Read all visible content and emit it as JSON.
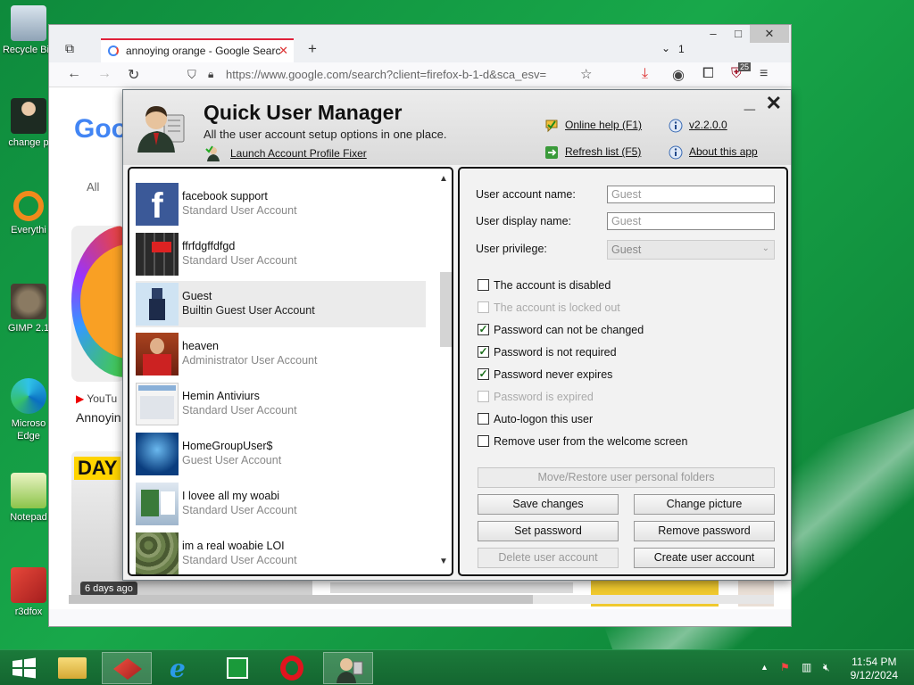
{
  "desktop": {
    "icons": [
      {
        "label": "Recycle Bin",
        "icon": "recycle-bin-icon"
      },
      {
        "label": "change p",
        "icon": "user-icon"
      },
      {
        "label": "Everythi",
        "icon": "everything-search-icon"
      },
      {
        "label": "GIMP 2.1",
        "icon": "gimp-icon"
      },
      {
        "label": "Microso Edge",
        "icon": "edge-icon"
      },
      {
        "label": "Notepad",
        "icon": "notepad-icon"
      },
      {
        "label": "r3dfox",
        "icon": "r3dfox-icon"
      }
    ]
  },
  "browser": {
    "tab_title": "annoying orange - Google Searc",
    "tab_count": "1",
    "url": "https://www.google.com/search?client=firefox-b-1-d&sca_esv=",
    "ext_badge": "25",
    "page": {
      "logo": "Goo",
      "tab_all": "All",
      "source": "YouTu",
      "result_title": "Annoyin",
      "days_ago": "6 days ago",
      "thumb_text": "DAY"
    }
  },
  "qum": {
    "title": "Quick User Manager",
    "subtitle": "All the user account setup options in one place.",
    "launch_link": "Launch Account Profile Fixer",
    "online_help": "Online help (F1)",
    "refresh_list": "Refresh list (F5)",
    "version": "v2.2.0.0",
    "about": "About this app",
    "users": [
      {
        "name": "facebook support",
        "type": "Standard User Account",
        "selected": false,
        "thumb": "facebook-icon"
      },
      {
        "name": "ffrfdgffdfgd",
        "type": "Standard User Account",
        "selected": false,
        "thumb": "keyboard-icon"
      },
      {
        "name": "Guest",
        "type": "Builtin Guest User Account",
        "selected": true,
        "thumb": "roblox-avatar-icon"
      },
      {
        "name": "heaven",
        "type": "Administrator User Account",
        "selected": false,
        "thumb": "painting-icon"
      },
      {
        "name": "Hemin Antiviurs",
        "type": "Standard User Account",
        "selected": false,
        "thumb": "window-icon"
      },
      {
        "name": "HomeGroupUser$",
        "type": "Guest User Account",
        "selected": false,
        "thumb": "homegroup-icon"
      },
      {
        "name": "I lovee all my woabi",
        "type": "Standard User Account",
        "selected": false,
        "thumb": "screenshot-icon"
      },
      {
        "name": "im a real woabie LOI",
        "type": "Standard User Account",
        "selected": false,
        "thumb": "camouflage-icon"
      }
    ],
    "details": {
      "account_name_label": "User account name:",
      "account_name_value": "Guest",
      "display_name_label": "User display name:",
      "display_name_value": "Guest",
      "privilege_label": "User privilege:",
      "privilege_value": "Guest"
    },
    "checkboxes": [
      {
        "label": "The account is disabled",
        "checked": false,
        "disabled": false
      },
      {
        "label": "The account is locked out",
        "checked": false,
        "disabled": true
      },
      {
        "label": "Password can not be changed",
        "checked": true,
        "disabled": false
      },
      {
        "label": "Password is not required",
        "checked": true,
        "disabled": false
      },
      {
        "label": "Password never expires",
        "checked": true,
        "disabled": false
      },
      {
        "label": "Password is expired",
        "checked": false,
        "disabled": true
      },
      {
        "label": "Auto-logon this user",
        "checked": false,
        "disabled": false
      },
      {
        "label": "Remove user from the welcome screen",
        "checked": false,
        "disabled": false
      }
    ],
    "buttons": {
      "move_restore": "Move/Restore user personal folders",
      "save_changes": "Save changes",
      "change_picture": "Change picture",
      "set_password": "Set password",
      "remove_password": "Remove password",
      "delete_user": "Delete user account",
      "create_user": "Create user account"
    }
  },
  "taskbar": {
    "time": "11:54 PM",
    "date": "9/12/2024",
    "apps": [
      "windows-start-icon",
      "file-explorer-icon",
      "r3dfox-icon",
      "internet-explorer-icon",
      "store-icon",
      "opera-icon",
      "quick-user-manager-icon"
    ]
  },
  "colors": {
    "desktop_green": "#0e8a3c",
    "tab_accent": "#e0213a",
    "check_green": "#1b6e1b"
  }
}
